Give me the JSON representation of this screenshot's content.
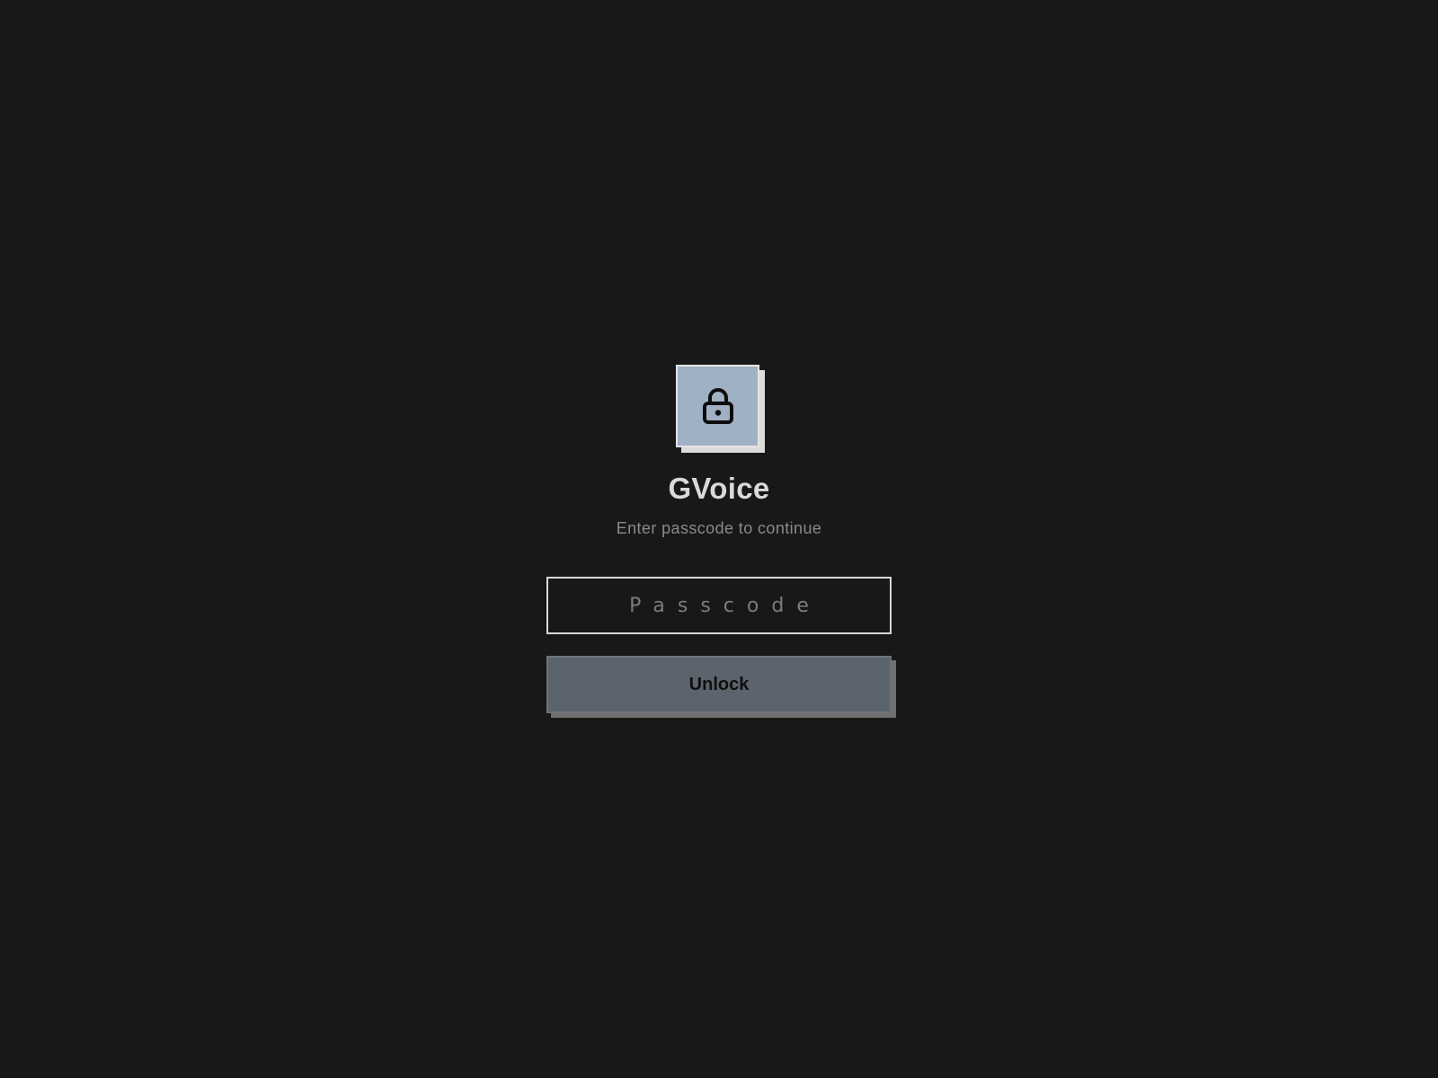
{
  "app": {
    "title": "GVoice",
    "subtitle": "Enter passcode to continue"
  },
  "lock_icon": {
    "icon": "lock-icon",
    "card_color": "#a0b1c4"
  },
  "passcode": {
    "placeholder": "Passcode",
    "value": ""
  },
  "unlock": {
    "label": "Unlock",
    "color": "#5b636c"
  },
  "colors": {
    "background": "#181818",
    "title": "#d9d9d9",
    "subtitle": "#8a8a8a"
  }
}
